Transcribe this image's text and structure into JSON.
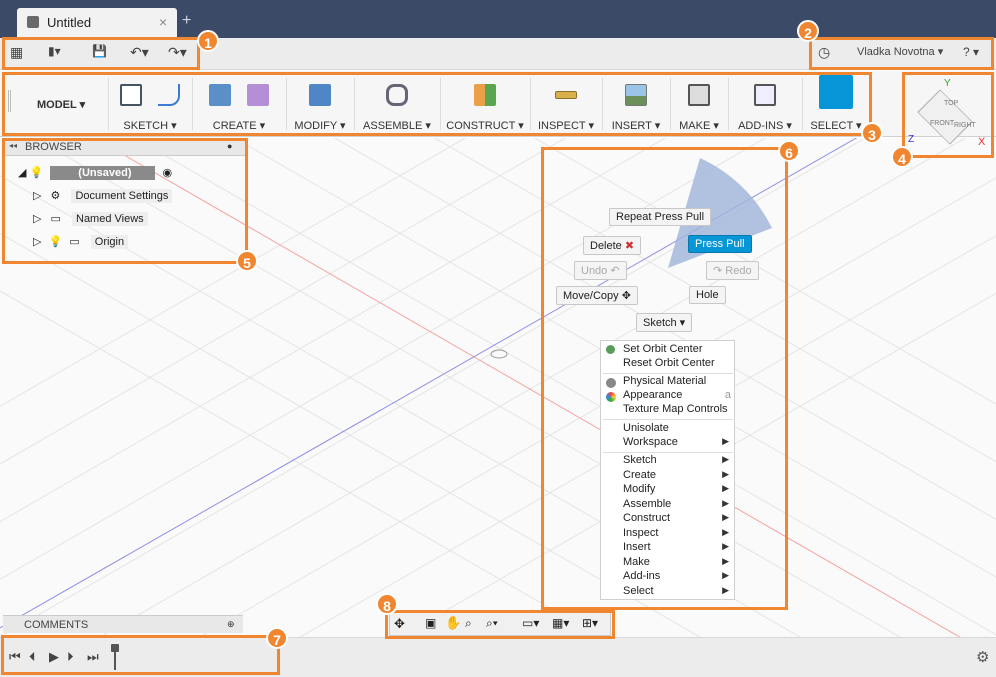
{
  "window": {
    "tab_title": "Untitled",
    "tab_close": "×",
    "new_tab": "+"
  },
  "quick_access": {
    "grid": "▦",
    "file": "▮▾",
    "save": "💾",
    "undo": "↶▾",
    "redo": "↷▾",
    "user": "Vladka Novotna ▾",
    "help": "? ▾",
    "clock": "◷"
  },
  "ribbon": {
    "workspace": "MODEL ▾",
    "groups": [
      {
        "label": "SKETCH ▾"
      },
      {
        "label": "CREATE ▾"
      },
      {
        "label": "MODIFY ▾"
      },
      {
        "label": "ASSEMBLE ▾"
      },
      {
        "label": "CONSTRUCT ▾"
      },
      {
        "label": "INSPECT ▾"
      },
      {
        "label": "INSERT ▾"
      },
      {
        "label": "MAKE ▾"
      },
      {
        "label": "ADD-INS ▾"
      },
      {
        "label": "SELECT ▾"
      }
    ]
  },
  "viewcube": {
    "top": "TOP",
    "front": "FRONT",
    "right": "RIGHT",
    "x": "X",
    "y": "Y",
    "z": "Z"
  },
  "browser": {
    "title": "BROWSER",
    "root": "(Unsaved)",
    "items": [
      "Document Settings",
      "Named Views",
      "Origin"
    ]
  },
  "marking_menu": {
    "repeat": "Repeat Press Pull",
    "delete": "Delete",
    "press_pull": "Press Pull",
    "undo": "Undo",
    "redo": "Redo",
    "move_copy": "Move/Copy",
    "hole": "Hole",
    "sketch": "Sketch ▾"
  },
  "context_menu": {
    "items": [
      "Set Orbit Center",
      "Reset Orbit Center",
      "Physical Material",
      "Appearance",
      "Texture Map Controls",
      "Unisolate",
      "Workspace",
      "Sketch",
      "Create",
      "Modify",
      "Assemble",
      "Construct",
      "Inspect",
      "Insert",
      "Make",
      "Add-ins",
      "Select"
    ],
    "appearance_shortcut": "a"
  },
  "comments": {
    "title": "COMMENTS"
  },
  "timeline": {
    "first": "⏮",
    "prev": "⏴",
    "play": "▶",
    "next": "⏵",
    "last": "⏭"
  },
  "badges": [
    "1",
    "2",
    "3",
    "4",
    "5",
    "6",
    "7",
    "8"
  ],
  "colors": {
    "accent": "#f08630",
    "primary": "#0696d7",
    "titlebar": "#3b4a66"
  }
}
